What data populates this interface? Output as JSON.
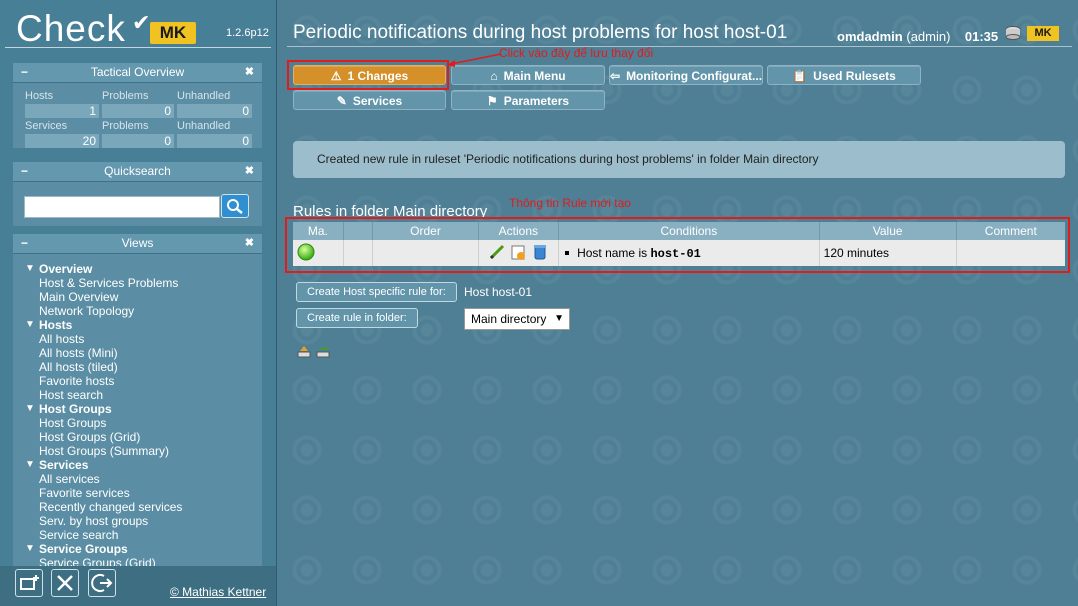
{
  "logo": {
    "text": "Check",
    "mk": "MK",
    "version": "1.2.6p12"
  },
  "tactical": {
    "title": "Tactical Overview",
    "cols": [
      "Hosts",
      "Problems",
      "Unhandled"
    ],
    "cols2": [
      "Services",
      "Problems",
      "Unhandled"
    ],
    "hosts": [
      "1",
      "0",
      "0"
    ],
    "services": [
      "20",
      "0",
      "0"
    ]
  },
  "quicksearch": {
    "title": "Quicksearch",
    "placeholder": ""
  },
  "views": {
    "title": "Views",
    "groups": [
      {
        "label": "Overview",
        "items": [
          "Host & Services Problems",
          "Main Overview",
          "Network Topology"
        ]
      },
      {
        "label": "Hosts",
        "items": [
          "All hosts",
          "All hosts (Mini)",
          "All hosts (tiled)",
          "Favorite hosts",
          "Host search"
        ]
      },
      {
        "label": "Host Groups",
        "items": [
          "Host Groups",
          "Host Groups (Grid)",
          "Host Groups (Summary)"
        ]
      },
      {
        "label": "Services",
        "items": [
          "All services",
          "Favorite services",
          "Recently changed services",
          "Serv. by host groups",
          "Service search"
        ]
      },
      {
        "label": "Service Groups",
        "items": [
          "Service Groups (Grid)"
        ]
      }
    ]
  },
  "footer": {
    "copyright": "© Mathias Kettner"
  },
  "header": {
    "title": "Periodic notifications during host problems for host host-01",
    "user": "omdadmin",
    "role": "(admin)",
    "time": "01:35",
    "mk": "MK"
  },
  "toolbar": {
    "changes": "1 Changes",
    "main_menu": "Main Menu",
    "monitoring": "Monitoring Configurat...",
    "used_rulesets": "Used Rulesets",
    "services": "Services",
    "parameters": "Parameters"
  },
  "annotations": {
    "click_here": "Click vào đây để lưu thay đổi",
    "rule_info": "Thông tin Rule mới tạo"
  },
  "message": "Created new rule in ruleset 'Periodic notifications during host problems' in folder Main directory",
  "rules": {
    "heading": "Rules in folder Main directory",
    "columns": [
      "Ma.",
      "Order",
      "Actions",
      "Conditions",
      "Value",
      "Comment"
    ],
    "row": {
      "condition_prefix": "Host name is ",
      "condition_host": "host-01",
      "value": "120 minutes",
      "comment": ""
    }
  },
  "create_host_rule": {
    "label": "Create Host specific rule for:",
    "host": "Host host-01"
  },
  "create_folder_rule": {
    "label": "Create rule in folder:",
    "folder": "Main directory"
  },
  "colors": {
    "accent_orange": "#d5902a",
    "annotation_red": "#e21b1b",
    "sidebar_bg": "#477f97"
  }
}
